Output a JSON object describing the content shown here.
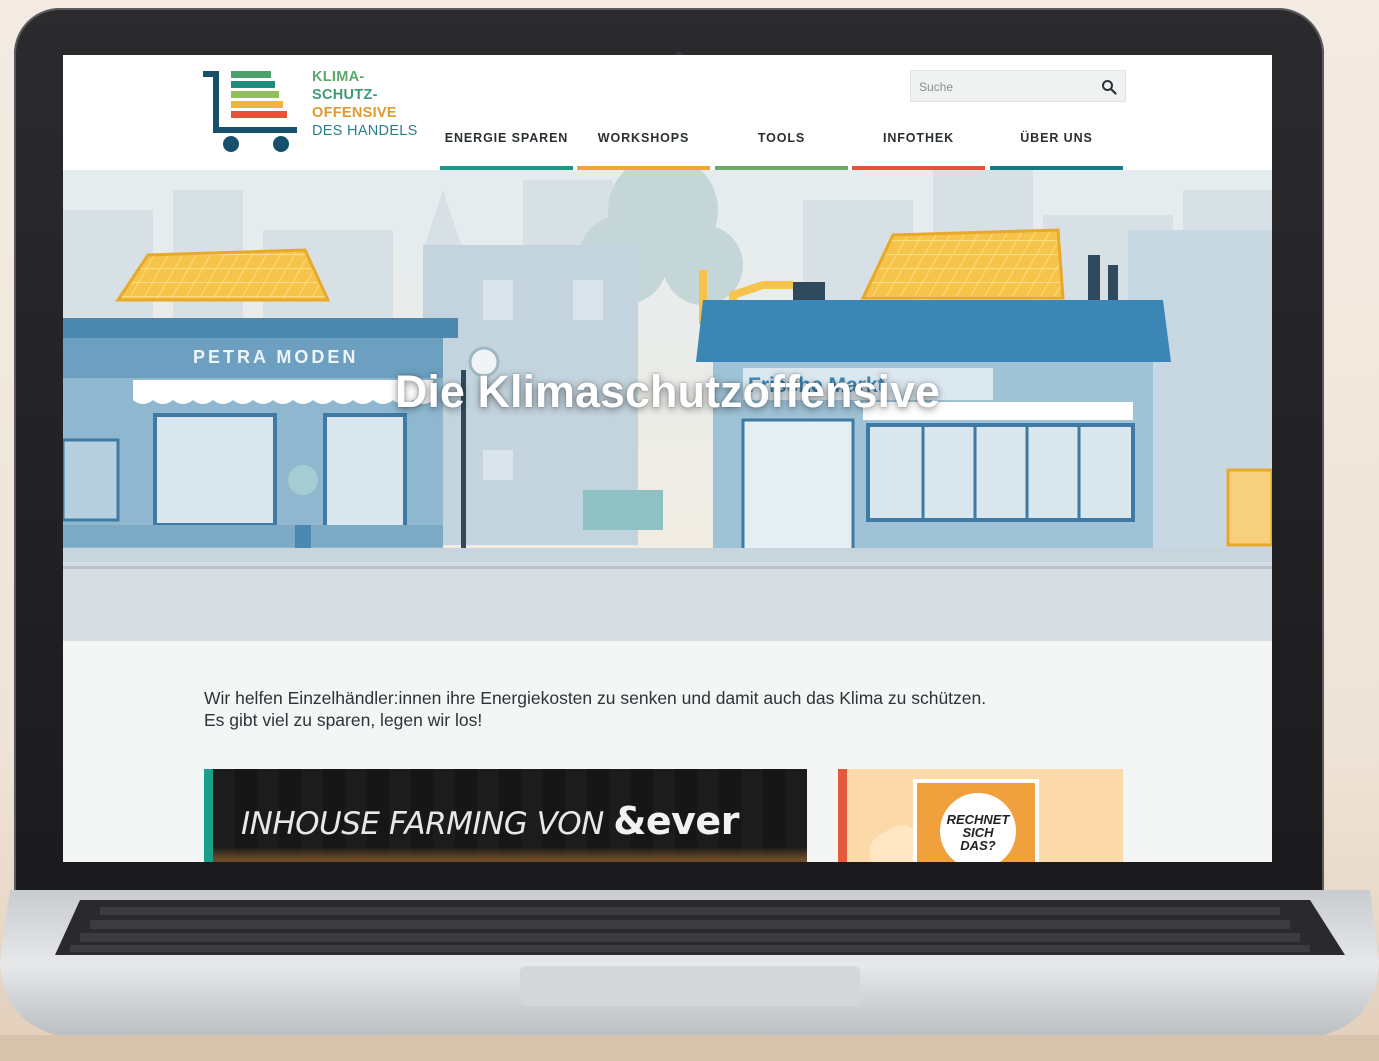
{
  "site": {
    "logo": {
      "line1": "KLIMA-",
      "line2": "SCHUTZ-",
      "line3": "OFFENSIVE",
      "line4": "DES HANDELS"
    },
    "search": {
      "placeholder": "Suche"
    },
    "nav": [
      {
        "label": "ENERGIE SPAREN",
        "color": "#1a9a86"
      },
      {
        "label": "WORKSHOPS",
        "color": "#f2a531"
      },
      {
        "label": "TOOLS",
        "color": "#6aab68"
      },
      {
        "label": "INFOTHEK",
        "color": "#e2553a"
      },
      {
        "label": "ÜBER UNS",
        "color": "#157a84"
      }
    ]
  },
  "hero": {
    "title": "Die Klimaschutzoffensive",
    "sign_left": "PETRA MODEN",
    "sign_right": "Frische Markt"
  },
  "intro": {
    "line1": "Wir helfen Einzelhändler:innen ihre Energiekosten zu senken und damit auch das Klima zu schützen.",
    "line2": "Es gibt viel zu sparen, legen wir los!"
  },
  "cards": {
    "card1": {
      "text_a": "INHOUSE FARMING VON",
      "text_b": "&ever"
    },
    "card2": {
      "badge_line1": "RECHNET",
      "badge_line2": "SICH",
      "badge_line3": "DAS?"
    }
  },
  "colors": {
    "accent_teal": "#1aa08a",
    "accent_red": "#e35a3c",
    "hero_sky": "#e7eef0"
  }
}
